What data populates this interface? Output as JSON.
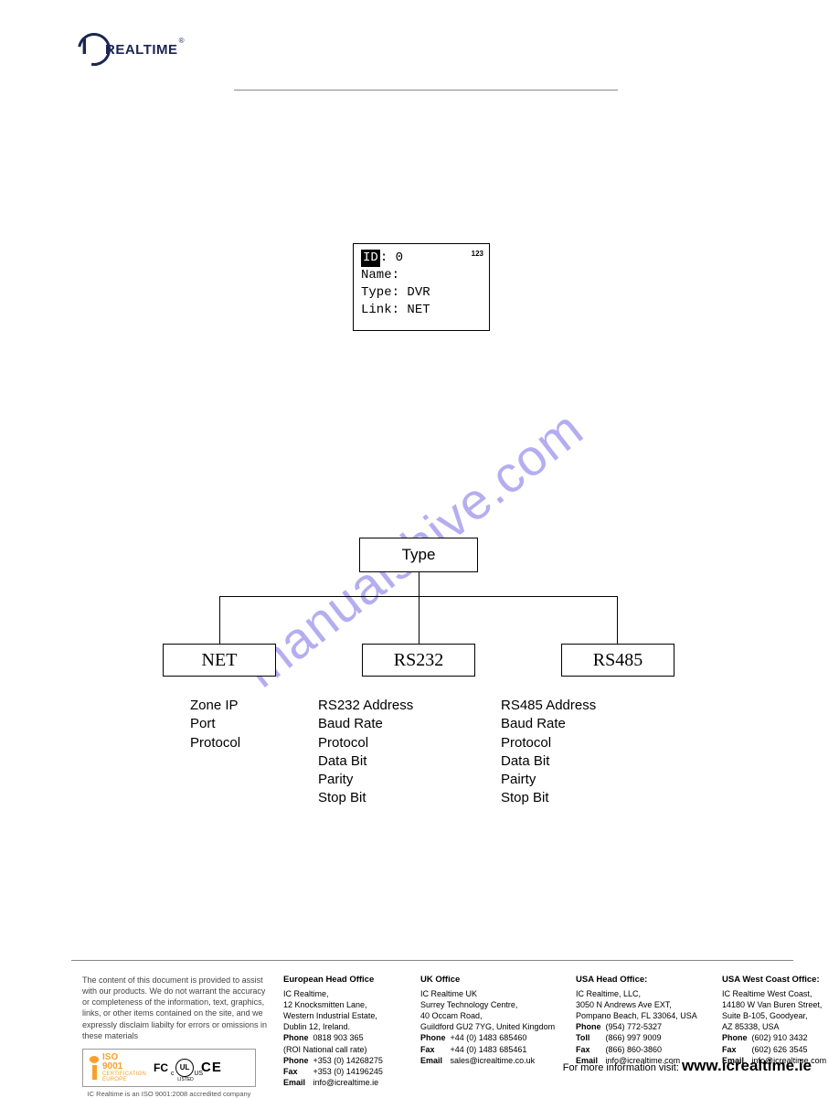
{
  "brand": {
    "name": "REALTIME",
    "reg": "®"
  },
  "device_box": {
    "id_label": "ID",
    "id_value": "0",
    "small": "123",
    "name_label": "Name:",
    "name_value": "",
    "type_label": "Type:",
    "type_value": "DVR",
    "link_label": "Link:",
    "link_value": "NET"
  },
  "watermark": "manualshive.com",
  "tree": {
    "root": "Type",
    "nodes": [
      "NET",
      "RS232",
      "RS485"
    ],
    "details": {
      "net": [
        "Zone IP",
        "Port",
        "Protocol"
      ],
      "rs232": [
        "RS232 Address",
        "Baud Rate",
        "Protocol",
        "Data Bit",
        "Parity",
        "Stop Bit"
      ],
      "rs485": [
        "RS485 Address",
        "Baud Rate",
        "Protocol",
        "Data Bit",
        "Pairty",
        "Stop Bit"
      ]
    }
  },
  "footer": {
    "disclaimer": "The content of this document is provided to assist with our products. We do not warrant the accuracy or completeness of the information, text, graphics, links, or other items contained on the site, and we expressly disclaim liabilty for errors or omissions in these materials",
    "iso_accredit": "IC Realtime is an ISO 9001:2008 accredited company",
    "iso_badge": {
      "big": "ISO",
      "num": "9001",
      "sub1": "CERTIFICATION",
      "sub2": "EUROPE"
    },
    "badges": {
      "fc": "FC",
      "ul": "UL",
      "ce": "CE"
    },
    "offices": {
      "eu": {
        "title": "European Head Office",
        "lines": [
          "IC Realtime,",
          "12 Knocksmitten Lane,",
          "Western Industrial Estate,",
          "Dublin 12, Ireland."
        ],
        "phone1_lbl": "Phone",
        "phone1": "0818 903 365",
        "roi": "(ROI National call rate)",
        "phone2_lbl": "Phone",
        "phone2": "+353 (0) 14268275",
        "fax_lbl": "Fax",
        "fax": "+353 (0) 14196245",
        "email_lbl": "Email",
        "email": "info@icrealtime.ie"
      },
      "uk": {
        "title": "UK Office",
        "lines": [
          "IC Realtime UK",
          "Surrey Technology Centre,",
          "40 Occam Road,",
          "Guildford GU2 7YG, United Kingdom"
        ],
        "phone_lbl": "Phone",
        "phone": "+44 (0) 1483 685460",
        "fax_lbl": "Fax",
        "fax": "+44 (0) 1483 685461",
        "email_lbl": "Email",
        "email": "sales@icrealtime.co.uk"
      },
      "usa": {
        "title": "USA Head Office:",
        "lines": [
          "IC Realtime, LLC,",
          "3050 N Andrews Ave EXT,",
          "Pompano Beach, FL 33064, USA"
        ],
        "phone_lbl": "Phone",
        "phone": "(954) 772-5327",
        "toll_lbl": "Toll",
        "toll": "(866) 997 9009",
        "fax_lbl": "Fax",
        "fax": "(866) 860-3860",
        "email_lbl": "Email",
        "email": "info@icrealtime.com"
      },
      "west": {
        "title": "USA West Coast Office:",
        "lines": [
          "IC Realtime West Coast,",
          "14180 W Van Buren Street,",
          "Suite B-105, Goodyear,",
          "AZ 85338, USA"
        ],
        "phone_lbl": "Phone",
        "phone": "(602) 910 3432",
        "fax_lbl": "Fax",
        "fax": "(602) 626 3545",
        "email_lbl": "Email",
        "email": "info@icrealtime.com"
      }
    },
    "more_info_pre": "For more information visit: ",
    "more_info_url": "www.icrealtime.ie"
  }
}
